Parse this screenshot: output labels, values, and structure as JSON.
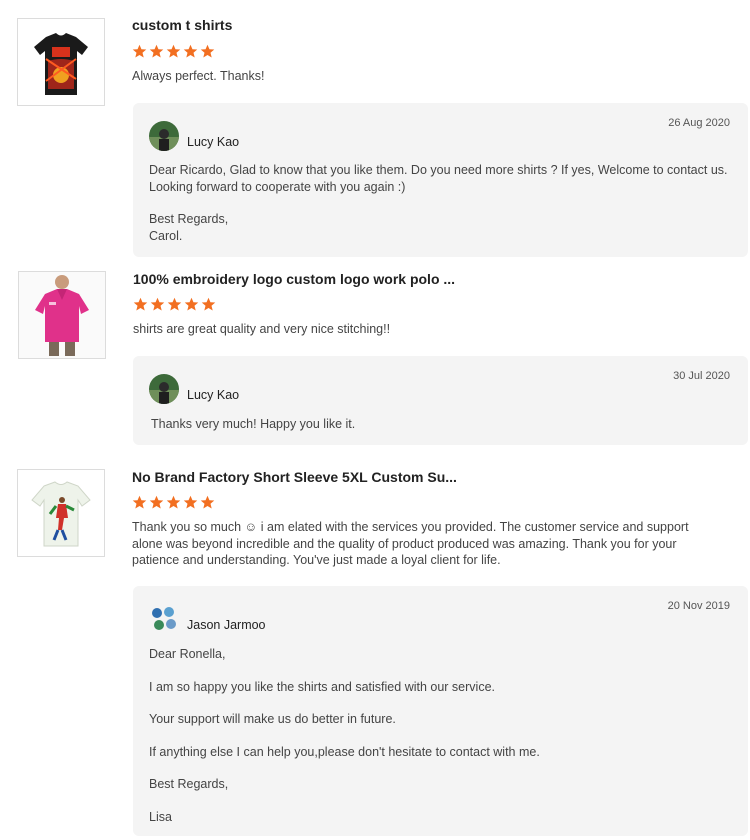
{
  "reviews": [
    {
      "title": "custom t shirts",
      "rating": 5,
      "comment": "Always perfect. Thanks!",
      "reply": {
        "date": "26 Aug 2020",
        "author": "Lucy Kao",
        "lines": [
          "Dear Ricardo,  Glad to know that you like them.  Do you need more shirts ? If yes, Welcome to contact us.",
          "Looking forward to cooperate with you again :)",
          "",
          "Best Regards,",
          "Carol."
        ]
      }
    },
    {
      "title": "100% embroidery logo custom logo work polo ...",
      "rating": 5,
      "comment": "shirts are great quality and very nice stitching!!",
      "reply": {
        "date": "30 Jul 2020",
        "author": "Lucy Kao",
        "lines": [
          "Thanks very much! Happy you like it."
        ]
      }
    },
    {
      "title": "No Brand Factory Short Sleeve 5XL Custom Su...",
      "rating": 5,
      "comment": "Thank you so much ☺ i am elated with the services you provided. The customer service and support alone was beyond incredible and the quality of product produced was amazing. Thank you for your patience and understanding. You've just made a loyal client for life.",
      "reply": {
        "date": "20 Nov 2019",
        "author": "Jason Jarmoo",
        "lines": [
          "Dear Ronella,",
          "I am so happy you like the shirts and satisfied with our service.",
          "Your support will make us do better in future.",
          "If anything else I can help you,please don't hesitate to contact with me.",
          "Best Regards,",
          "Lisa"
        ]
      }
    }
  ],
  "colors": {
    "star": "#f26f21",
    "reply_bg": "#f4f4f4"
  }
}
